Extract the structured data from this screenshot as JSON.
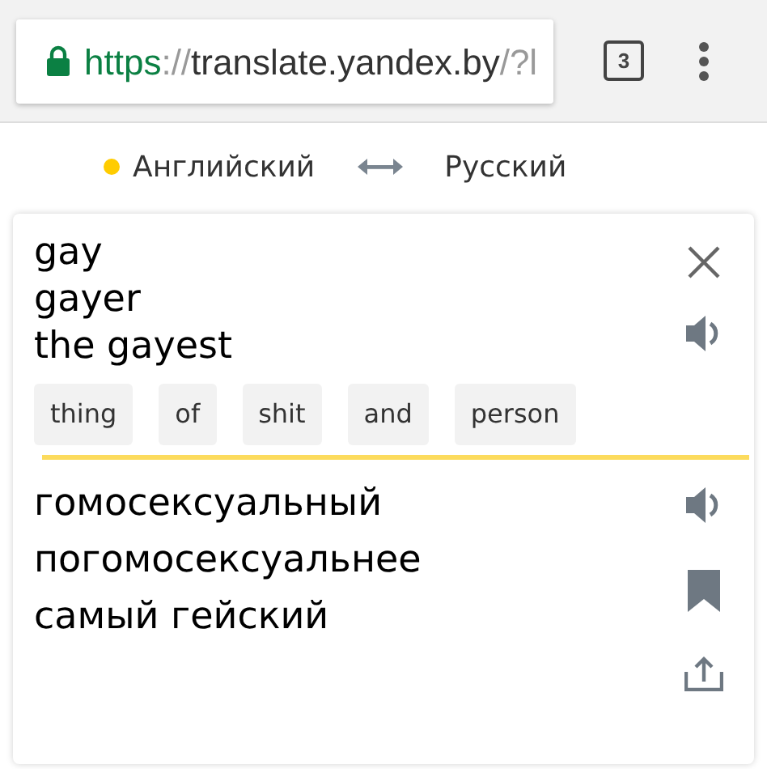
{
  "browser": {
    "url_parts": [
      {
        "text": "https",
        "kind": "scheme"
      },
      {
        "text": "://",
        "kind": "muted"
      },
      {
        "text": "translate.yandex.by",
        "kind": "host"
      },
      {
        "text": "/?l",
        "kind": "muted"
      }
    ],
    "tab_count": "3"
  },
  "languages": {
    "source": "Английский",
    "target": "Русский"
  },
  "source": {
    "lines": [
      "gay",
      "gayer",
      "the gayest"
    ],
    "chips": [
      "thing",
      "of",
      "shit",
      "and",
      "person"
    ]
  },
  "translation": {
    "lines": [
      "гомосексуальный",
      "погомосексуальнее",
      "самый гейский"
    ]
  }
}
